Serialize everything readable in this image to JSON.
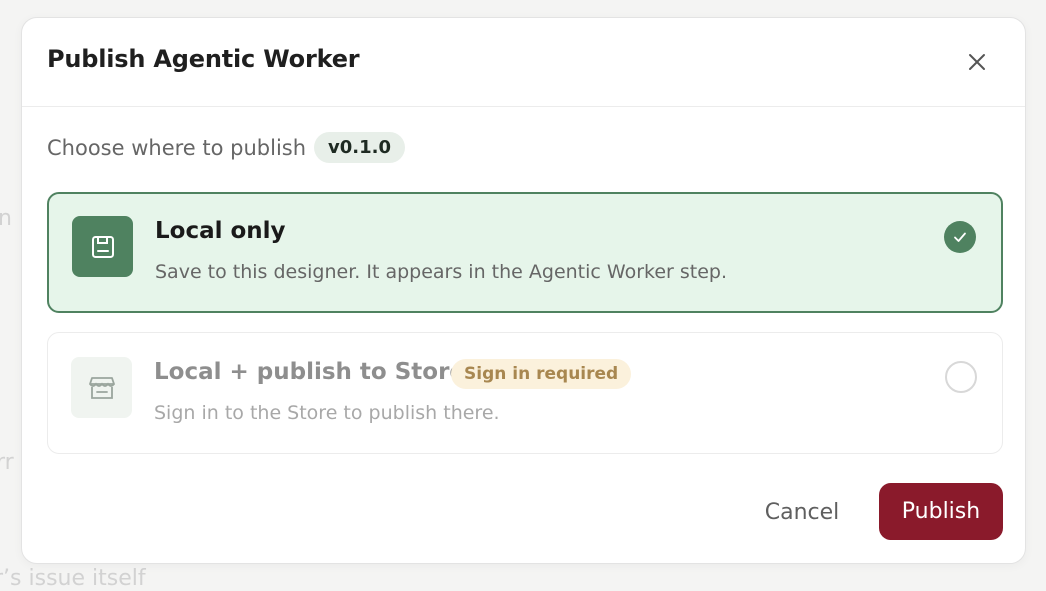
{
  "background": {
    "fragments": [
      "n",
      "rr",
      "r’s issue itself"
    ]
  },
  "modal": {
    "title": "Publish Agentic Worker",
    "close_icon": "close-icon",
    "subtitle": "Choose where to publish",
    "version": "v0.1.0",
    "options": [
      {
        "title": "Local only",
        "description": "Save to this designer. It appears in the Agentic Worker step.",
        "icon": "save-icon",
        "selected": true
      },
      {
        "title": "Local + publish to Store",
        "badge": "Sign in required",
        "description": "Sign in to the Store to publish there.",
        "icon": "store-icon",
        "selected": false
      }
    ],
    "cancel_label": "Cancel",
    "publish_label": "Publish"
  },
  "colors": {
    "accent_green": "#4f8260",
    "selected_bg": "#e6f5ea",
    "publish_button": "#8a1a2b",
    "badge_warning_bg": "#fbf1dc",
    "badge_warning_text": "#a88750"
  }
}
